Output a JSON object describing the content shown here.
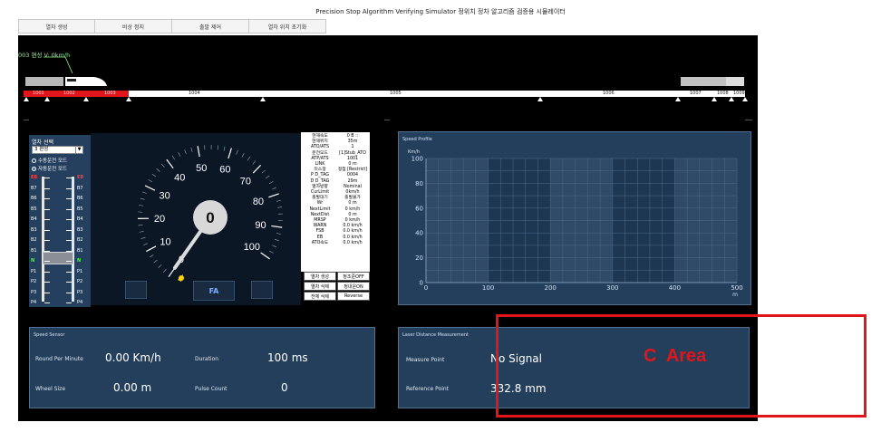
{
  "window": {
    "title": "Precision Stop Algorithm Verifying Simulator 정위치 정차 알고리즘 검증용 시뮬레이터"
  },
  "menu": [
    "열차 생성",
    "비상 정지",
    "출발 제어",
    "열차 위치 초기화"
  ],
  "train": {
    "speed_label": "003 편성 V: 0km/h"
  },
  "track": {
    "segments": [
      "1001",
      "1002",
      "1003",
      "1004",
      "1005",
      "1006",
      "1007",
      "1008",
      "1009"
    ]
  },
  "mode_panel": {
    "title": "열차 선택",
    "selected_train": "3 편성",
    "radio_manual": "수동운전 모드",
    "radio_auto": "자동운전 모드",
    "notches_left": [
      "EB",
      "B7",
      "B6",
      "B5",
      "B4",
      "B3",
      "B2",
      "B1",
      "N",
      "P1",
      "P2",
      "P3",
      "P4"
    ],
    "notches_right": [
      "EB",
      "B7",
      "B6",
      "B5",
      "B4",
      "B3",
      "B2",
      "B1",
      "N",
      "P1",
      "P2",
      "P3",
      "P4"
    ]
  },
  "gauge": {
    "value": 0,
    "display": "0",
    "ticks": [
      "0",
      "10",
      "20",
      "30",
      "40",
      "50",
      "60",
      "70",
      "80",
      "90",
      "100"
    ],
    "mode_label": "FA"
  },
  "info_table": {
    "rows": [
      {
        "k": "현재속도",
        "v": "0 B ::"
      },
      {
        "k": "현재위치",
        "v": "35m"
      },
      {
        "k": "ATO/ATS",
        "v": "1"
      },
      {
        "k": "운전모드",
        "v": "[1]Stub_ATO"
      },
      {
        "k": "ATP/ATS",
        "v": "1001"
      },
      {
        "k": "LINK",
        "v": "0 m"
      },
      {
        "k": "미스정",
        "v": "정점 [Restrict]"
      },
      {
        "k": "P D_TAG",
        "v": "0004"
      },
      {
        "k": "D D_TAG",
        "v": "29m"
      },
      {
        "k": "열차방향",
        "v": "Nominal"
      },
      {
        "k": "CurLimit",
        "v": "0km/h"
      },
      {
        "k": "출발대기",
        "v": "출발불가"
      },
      {
        "k": "Wr",
        "v": "0 m"
      },
      {
        "k": "NextLimit",
        "v": "0 km/h"
      },
      {
        "k": "NextDist",
        "v": "0 m"
      },
      {
        "k": "MRSP",
        "v": "0 km/h"
      },
      {
        "k": "WARN",
        "v": "0.0 km/h"
      },
      {
        "k": "FSB",
        "v": "0.0 km/h"
      },
      {
        "k": "EB",
        "v": "0.0 km/h"
      },
      {
        "k": "ATO속도",
        "v": "0.0 km/h"
      }
    ]
  },
  "control_buttons": [
    "열차 생성",
    "정조준OFF",
    "열차 삭제",
    "정내운ON",
    "전체 삭제",
    "Reverse"
  ],
  "speed_profile": {
    "title": "Speed Profile",
    "y_unit": "Km/h"
  },
  "chart_data": {
    "type": "area",
    "title": "Speed Profile",
    "xlabel": "m",
    "ylabel": "Km/h",
    "x_ticks": [
      "0",
      "100",
      "200",
      "300",
      "400",
      "500"
    ],
    "y_ticks": [
      "0",
      "20",
      "40",
      "60",
      "80",
      "100"
    ],
    "xlim": [
      0,
      500
    ],
    "ylim": [
      0,
      100
    ],
    "highlight_bands": [
      [
        100,
        200
      ],
      [
        300,
        400
      ]
    ],
    "series": [],
    "grid": true
  },
  "speed_sensor": {
    "title": "Speed Sensor",
    "rpm_label": "Round Per Minute",
    "rpm_value": "0.00 Km/h",
    "duration_label": "Duration",
    "duration_value": "100 ms",
    "wheel_label": "Wheel Size",
    "wheel_value": "0.00 m",
    "pulse_label": "Pulse Count",
    "pulse_value": "0"
  },
  "laser": {
    "title": "Laser Distance Measurement",
    "measure_label": "Measure Point",
    "measure_value": "No Signal",
    "reference_label": "Reference Point",
    "reference_value": "332.8 mm"
  },
  "annotation": {
    "label": "C  Area",
    "color": "#e0161b"
  },
  "colors": {
    "panel": "#243f5c",
    "track_occupied": "#e0161b",
    "background": "#000000"
  }
}
